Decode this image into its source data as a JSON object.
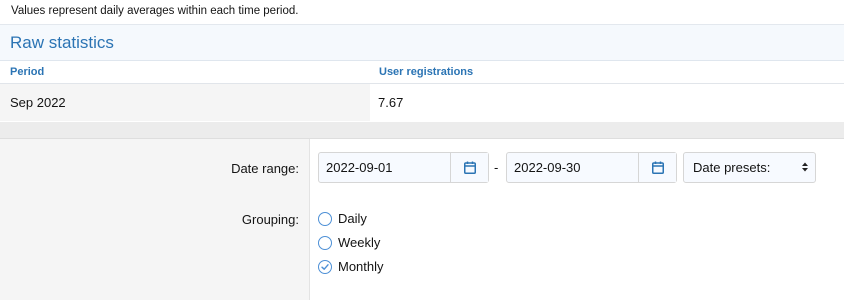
{
  "note": "Values represent daily averages within each time period.",
  "stats": {
    "title": "Raw statistics",
    "columns": [
      "Period",
      "User registrations"
    ],
    "rows": [
      [
        "Sep 2022",
        "7.67"
      ]
    ]
  },
  "form": {
    "date_range_label": "Date range:",
    "date_from": "2022-09-01",
    "date_separator": "-",
    "date_to": "2022-09-30",
    "date_presets": "Date presets:",
    "grouping_label": "Grouping:",
    "grouping_options": [
      {
        "label": "Daily",
        "checked": false
      },
      {
        "label": "Weekly",
        "checked": false
      },
      {
        "label": "Monthly",
        "checked": true
      }
    ]
  },
  "colors": {
    "accent": "#2b74b4",
    "radio": "#4d90d6"
  }
}
